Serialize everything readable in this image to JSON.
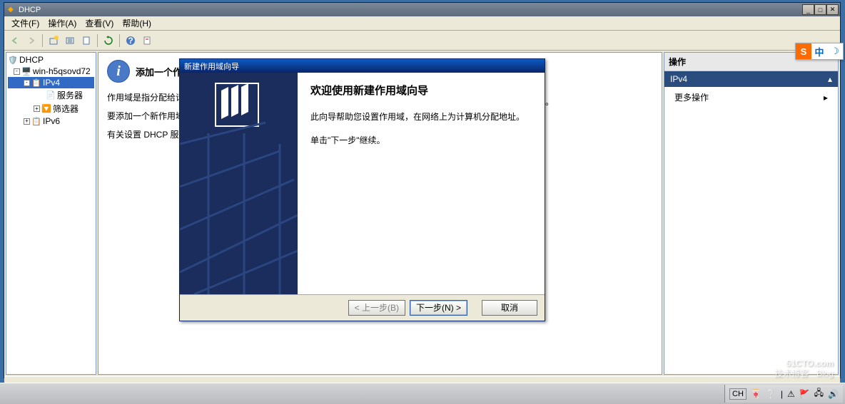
{
  "window": {
    "title": "DHCP",
    "menu": {
      "file": "文件(F)",
      "action": "操作(A)",
      "view": "查看(V)",
      "help": "帮助(H)"
    }
  },
  "tree": {
    "root": "DHCP",
    "server": "win-h5qsovd72",
    "ipv4": "IPv4",
    "server_opts": "服务器",
    "filters": "筛选器",
    "ipv6": "IPv6"
  },
  "content": {
    "heading": "添加一个作用域",
    "p1": "作用域是指分配给请",
    "p2": "要添加一个新作用域",
    "p3": "有关设置 DHCP 服务",
    "truncated_suffix": "址。"
  },
  "actions": {
    "header": "操作",
    "section": "IPv4",
    "more": "更多操作"
  },
  "wizard": {
    "title": "新建作用域向导",
    "welcome": "欢迎使用新建作用域向导",
    "desc": "此向导帮助您设置作用域，在网络上为计算机分配地址。",
    "cont": "单击\"下一步\"继续。",
    "back": "< 上一步(B)",
    "next": "下一步(N) >",
    "cancel": "取消"
  },
  "taskbar": {
    "lang": "CH"
  },
  "ime": {
    "s": "S",
    "zh": "中",
    "moon": "☽"
  },
  "watermark": {
    "main": "51CTO.com",
    "sub": "技术博客",
    "tag": "Blog"
  }
}
